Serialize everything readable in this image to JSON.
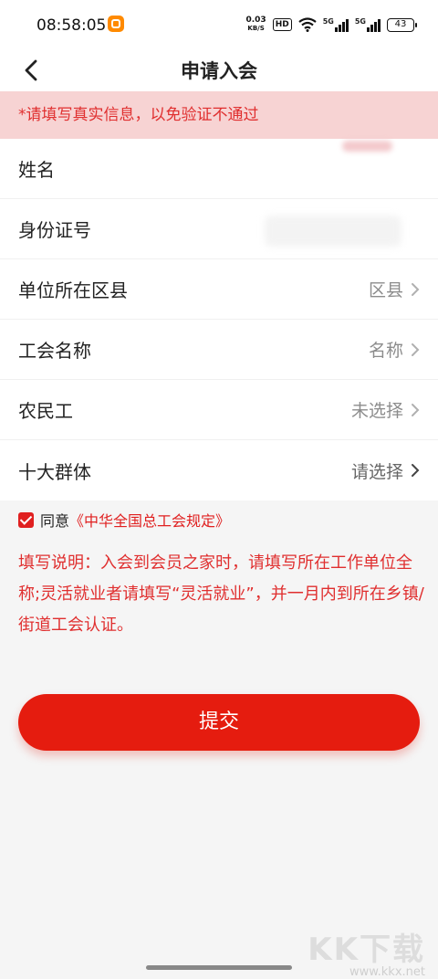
{
  "status_bar": {
    "time": "08:58:05",
    "net_speed_value": "0.03",
    "net_speed_unit": "KB/S",
    "hd": "HD",
    "signal_1": "5G",
    "signal_2": "5G",
    "battery": "43"
  },
  "header": {
    "title": "申请入会"
  },
  "notice": "*请填写真实信息，以免验证不通过",
  "form": {
    "rows": [
      {
        "label": "姓名",
        "value": ""
      },
      {
        "label": "身份证号",
        "value": ""
      },
      {
        "label": "单位所在区县",
        "value": "区县"
      },
      {
        "label": "工会名称",
        "value": "名称"
      },
      {
        "label": "农民工",
        "value": "未选择"
      },
      {
        "label": "十大群体",
        "value": "请选择"
      }
    ]
  },
  "agreement": {
    "checked": true,
    "text": "同意",
    "link": "《中华全国总工会规定》"
  },
  "instructions": "填写说明：入会到会员之家时，请填写所在工作单位全称;灵活就业者请填写“灵活就业”，并一月内到所在乡镇/街道工会认证。",
  "submit_label": "提交",
  "watermark": {
    "logo": "KK下载",
    "url": "www.kkx.net"
  },
  "colors": {
    "accent": "#e51c0f",
    "notice_bg": "#f7d3d3",
    "notice_text": "#e02f2f"
  }
}
